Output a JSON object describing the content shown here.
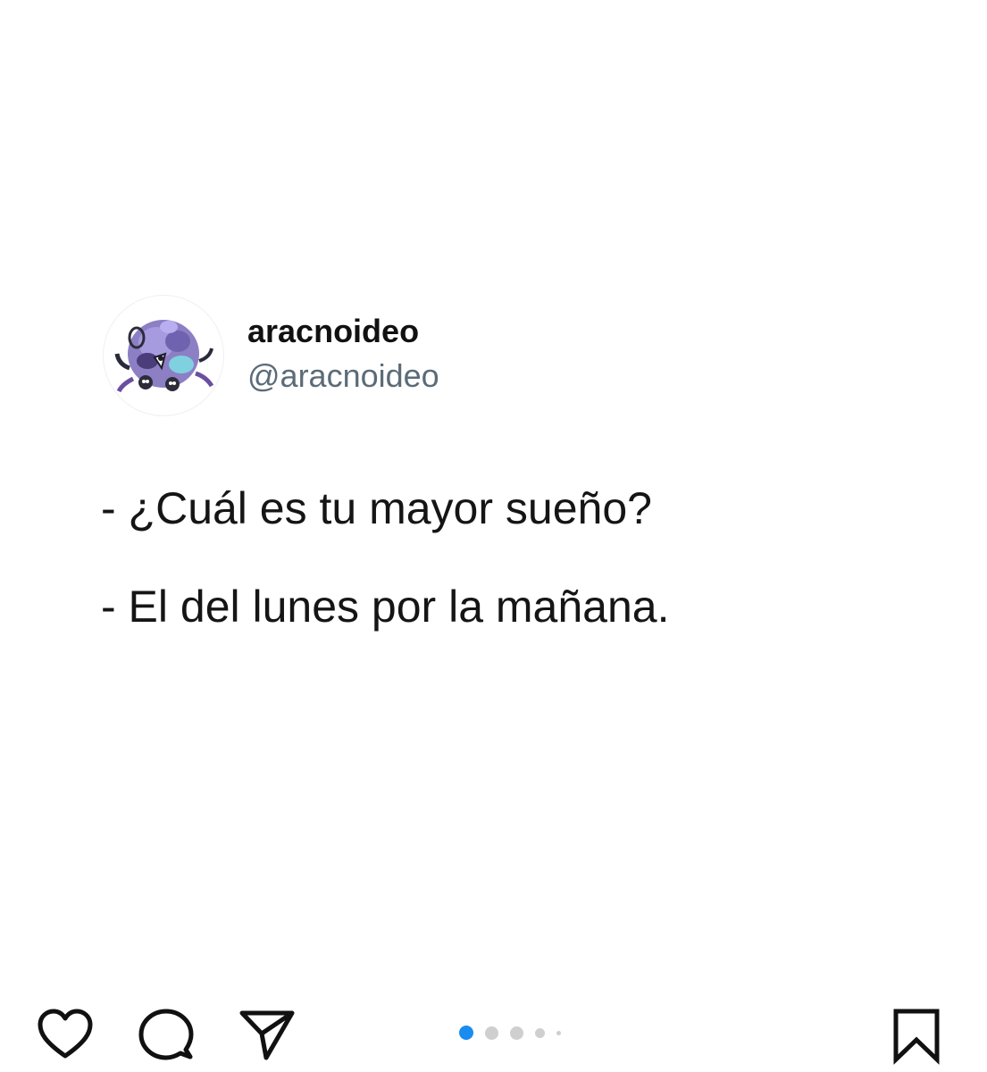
{
  "post": {
    "author": {
      "display_name": "aracnoideo",
      "handle": "@aracnoideo",
      "avatar_icon": "spider-creature-avatar-icon"
    },
    "lines": [
      "- ¿Cuál es tu mayor sueño?",
      "- El del lunes por la mañana."
    ]
  },
  "actions": {
    "icons": [
      "heart-icon",
      "comment-icon",
      "share-icon",
      "bookmark-icon"
    ]
  },
  "carousel": {
    "total_dots": 5,
    "active_index": 0,
    "active_color": "#1a8cf0",
    "inactive_color": "#cfcfcf"
  }
}
